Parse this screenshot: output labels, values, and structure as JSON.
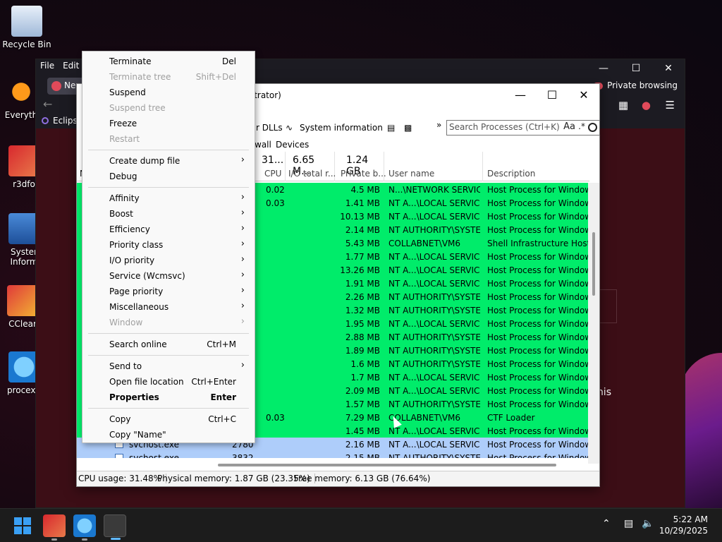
{
  "desktop": {
    "icons": [
      "Recycle Bin",
      "Everyth",
      "r3dfo",
      "Syster Inform",
      "CClear",
      "procexp"
    ],
    "right_text": "his"
  },
  "firefox": {
    "menu": [
      "File",
      "Edit"
    ],
    "tab": "Ne",
    "private": "Private browsing",
    "bookmark": "Eclips"
  },
  "pe": {
    "title": "nistrator)",
    "toolbar": [
      "r DLLs",
      "System information"
    ],
    "search_placeholder": "Search Processes (Ctrl+K)",
    "search_aa": "Aa",
    "tabs": [
      "wall",
      "Devices"
    ],
    "header": {
      "cpu_big": "31...",
      "io_big": "6.65 M...",
      "priv_big": "1.24 GB",
      "cpu": "CPU",
      "io": "I/O total r...",
      "priv": "Private b...",
      "user": "User name",
      "desc": "Description",
      "first": "N"
    },
    "rows": [
      {
        "cpu": "0.02",
        "mem": "4.5 MB",
        "user": "N...\\NETWORK SERVICE",
        "desc": "Host Process for Windows S"
      },
      {
        "cpu": "0.03",
        "mem": "1.41 MB",
        "user": "NT A...\\LOCAL SERVICE",
        "desc": "Host Process for Windows S"
      },
      {
        "cpu": "",
        "mem": "10.13 MB",
        "user": "NT A...\\LOCAL SERVICE",
        "desc": "Host Process for Windows S"
      },
      {
        "cpu": "",
        "mem": "2.14 MB",
        "user": "NT AUTHORITY\\SYSTEM",
        "desc": "Host Process for Windows S"
      },
      {
        "cpu": "",
        "mem": "5.43 MB",
        "user": "COLLABNET\\VM6",
        "desc": "Shell Infrastructure Host"
      },
      {
        "cpu": "",
        "mem": "1.77 MB",
        "user": "NT A...\\LOCAL SERVICE",
        "desc": "Host Process for Windows S"
      },
      {
        "cpu": "",
        "mem": "13.26 MB",
        "user": "NT A...\\LOCAL SERVICE",
        "desc": "Host Process for Windows S"
      },
      {
        "cpu": "",
        "mem": "1.91 MB",
        "user": "NT A...\\LOCAL SERVICE",
        "desc": "Host Process for Windows S"
      },
      {
        "cpu": "",
        "mem": "2.26 MB",
        "user": "NT AUTHORITY\\SYSTEM",
        "desc": "Host Process for Windows S"
      },
      {
        "cpu": "",
        "mem": "1.32 MB",
        "user": "NT AUTHORITY\\SYSTEM",
        "desc": "Host Process for Windows S"
      },
      {
        "cpu": "",
        "mem": "1.95 MB",
        "user": "NT A...\\LOCAL SERVICE",
        "desc": "Host Process for Windows S"
      },
      {
        "cpu": "",
        "mem": "2.88 MB",
        "user": "NT AUTHORITY\\SYSTEM",
        "desc": "Host Process for Windows S"
      },
      {
        "cpu": "",
        "mem": "1.89 MB",
        "user": "NT AUTHORITY\\SYSTEM",
        "desc": "Host Process for Windows S"
      },
      {
        "cpu": "",
        "mem": "1.6 MB",
        "user": "NT AUTHORITY\\SYSTEM",
        "desc": "Host Process for Windows S"
      },
      {
        "cpu": "",
        "mem": "1.7 MB",
        "user": "NT A...\\LOCAL SERVICE",
        "desc": "Host Process for Windows S"
      },
      {
        "cpu": "",
        "mem": "2.09 MB",
        "user": "NT A...\\LOCAL SERVICE",
        "desc": "Host Process for Windows S"
      },
      {
        "cpu": "",
        "mem": "1.57 MB",
        "user": "NT AUTHORITY\\SYSTEM",
        "desc": "Host Process for Windows S"
      },
      {
        "cpu": "0.03",
        "mem": "7.29 MB",
        "user": "COLLABNET\\VM6",
        "desc": "CTF Loader"
      },
      {
        "cpu": "",
        "mem": "1.45 MB",
        "user": "NT A...\\LOCAL SERVICE",
        "desc": "Host Process for Windows S"
      }
    ],
    "blue_rows": [
      {
        "name": "svchost.exe",
        "pid": "2780",
        "mem": "2.16 MB",
        "user": "NT A...\\LOCAL SERVICE",
        "desc": "Host Process for Windows S"
      },
      {
        "name": "svchost.exe",
        "pid": "3832",
        "mem": "2.15 MB",
        "user": "NT AUTHORITY\\SYSTEM",
        "desc": "Host Process for Windows S"
      }
    ],
    "status": {
      "cpu": "CPU usage: 31.48%",
      "phys": "Physical memory: 1.87 GB (23.35%)",
      "free": "Free memory: 6.13 GB (76.64%)"
    }
  },
  "menu": [
    {
      "label": "Terminate",
      "key": "Del"
    },
    {
      "label": "Terminate tree",
      "key": "Shift+Del",
      "disabled": true
    },
    {
      "label": "Suspend"
    },
    {
      "label": "Suspend tree",
      "disabled": true
    },
    {
      "label": "Freeze"
    },
    {
      "label": "Restart",
      "disabled": true
    },
    {
      "sep": true
    },
    {
      "label": "Create dump file",
      "sub": true
    },
    {
      "label": "Debug"
    },
    {
      "sep": true
    },
    {
      "label": "Affinity",
      "sub": true
    },
    {
      "label": "Boost",
      "sub": true
    },
    {
      "label": "Efficiency",
      "sub": true
    },
    {
      "label": "Priority class",
      "sub": true
    },
    {
      "label": "I/O priority",
      "sub": true
    },
    {
      "label": "Service (Wcmsvc)",
      "sub": true
    },
    {
      "label": "Page priority",
      "sub": true
    },
    {
      "label": "Miscellaneous",
      "sub": true
    },
    {
      "label": "Window",
      "sub": true,
      "disabled": true
    },
    {
      "sep": true
    },
    {
      "label": "Search online",
      "key": "Ctrl+M"
    },
    {
      "sep": true
    },
    {
      "label": "Send to",
      "sub": true
    },
    {
      "label": "Open file location",
      "key": "Ctrl+Enter"
    },
    {
      "label": "Properties",
      "key": "Enter",
      "bold": true
    },
    {
      "sep": true
    },
    {
      "label": "Copy",
      "key": "Ctrl+C"
    },
    {
      "label": "Copy \"Name\""
    }
  ],
  "taskbar": {
    "time": "5:22 AM",
    "date": "10/29/2025"
  }
}
